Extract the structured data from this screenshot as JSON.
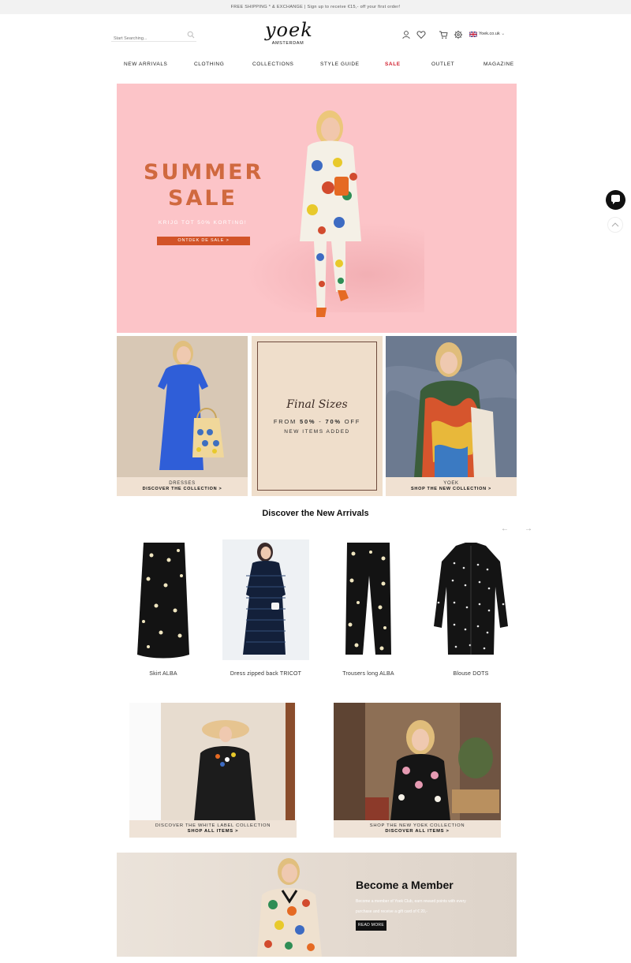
{
  "promo": {
    "text": "FREE SHIPPING * & EXCHANGE | Sign up to receive €15,- off your first order!"
  },
  "header": {
    "search_placeholder": "Start Searching...",
    "logo_word": "yoek",
    "logo_sub": "AMSTERDAM",
    "locale": "Yoek.co.uk"
  },
  "nav": {
    "items": [
      "NEW ARRIVALS",
      "CLOTHING",
      "COLLECTIONS",
      "STYLE GUIDE",
      "SALE",
      "OUTLET",
      "MAGAZINE"
    ]
  },
  "hero": {
    "title_line1": "SUMMER",
    "title_line2": "SALE",
    "subtitle": "KRIJG TOT 50% KORTING!",
    "cta": "ONTDEK DE SALE >"
  },
  "tiles": [
    {
      "title": "DRESSES",
      "cta": "DISCOVER THE COLLECTION >"
    },
    {
      "script": "Final Sizes",
      "from_prefix": "FROM ",
      "from_a": "50%",
      "from_mid": " - ",
      "from_b": "70%",
      "from_suffix": " OFF",
      "new_items": "NEW ITEMS ADDED"
    },
    {
      "title": "YOEK",
      "cta": "SHOP THE NEW COLLECTION >"
    }
  ],
  "new_arrivals": {
    "title": "Discover the New Arrivals",
    "prev_arrow": "←",
    "next_arrow": "→",
    "products": [
      {
        "name": "Skirt ALBA"
      },
      {
        "name": "Dress zipped back TRICOT"
      },
      {
        "name": "Trousers long ALBA"
      },
      {
        "name": "Blouse DOTS"
      }
    ]
  },
  "banners": [
    {
      "line1": "DISCOVER THE WHITE LABEL COLLECTION",
      "line2": "SHOP ALL ITEMS >"
    },
    {
      "line1": "SHOP THE NEW YOEK COLLECTION",
      "line2": "DISCOVER ALL ITEMS >"
    }
  ],
  "member": {
    "title": "Become a Member",
    "text_line1": "Become a member of Yoek Club, earn reward points with every",
    "text_line2": "purchase and receive a gift card of € 20,-",
    "button": "READ MORE"
  },
  "colors": {
    "hero_bg": "#fcc4c8",
    "hero_title": "#d0693f",
    "hero_cta": "#d25328",
    "sale_nav": "#d1202f",
    "caption_bg": "#f0e1d2"
  }
}
